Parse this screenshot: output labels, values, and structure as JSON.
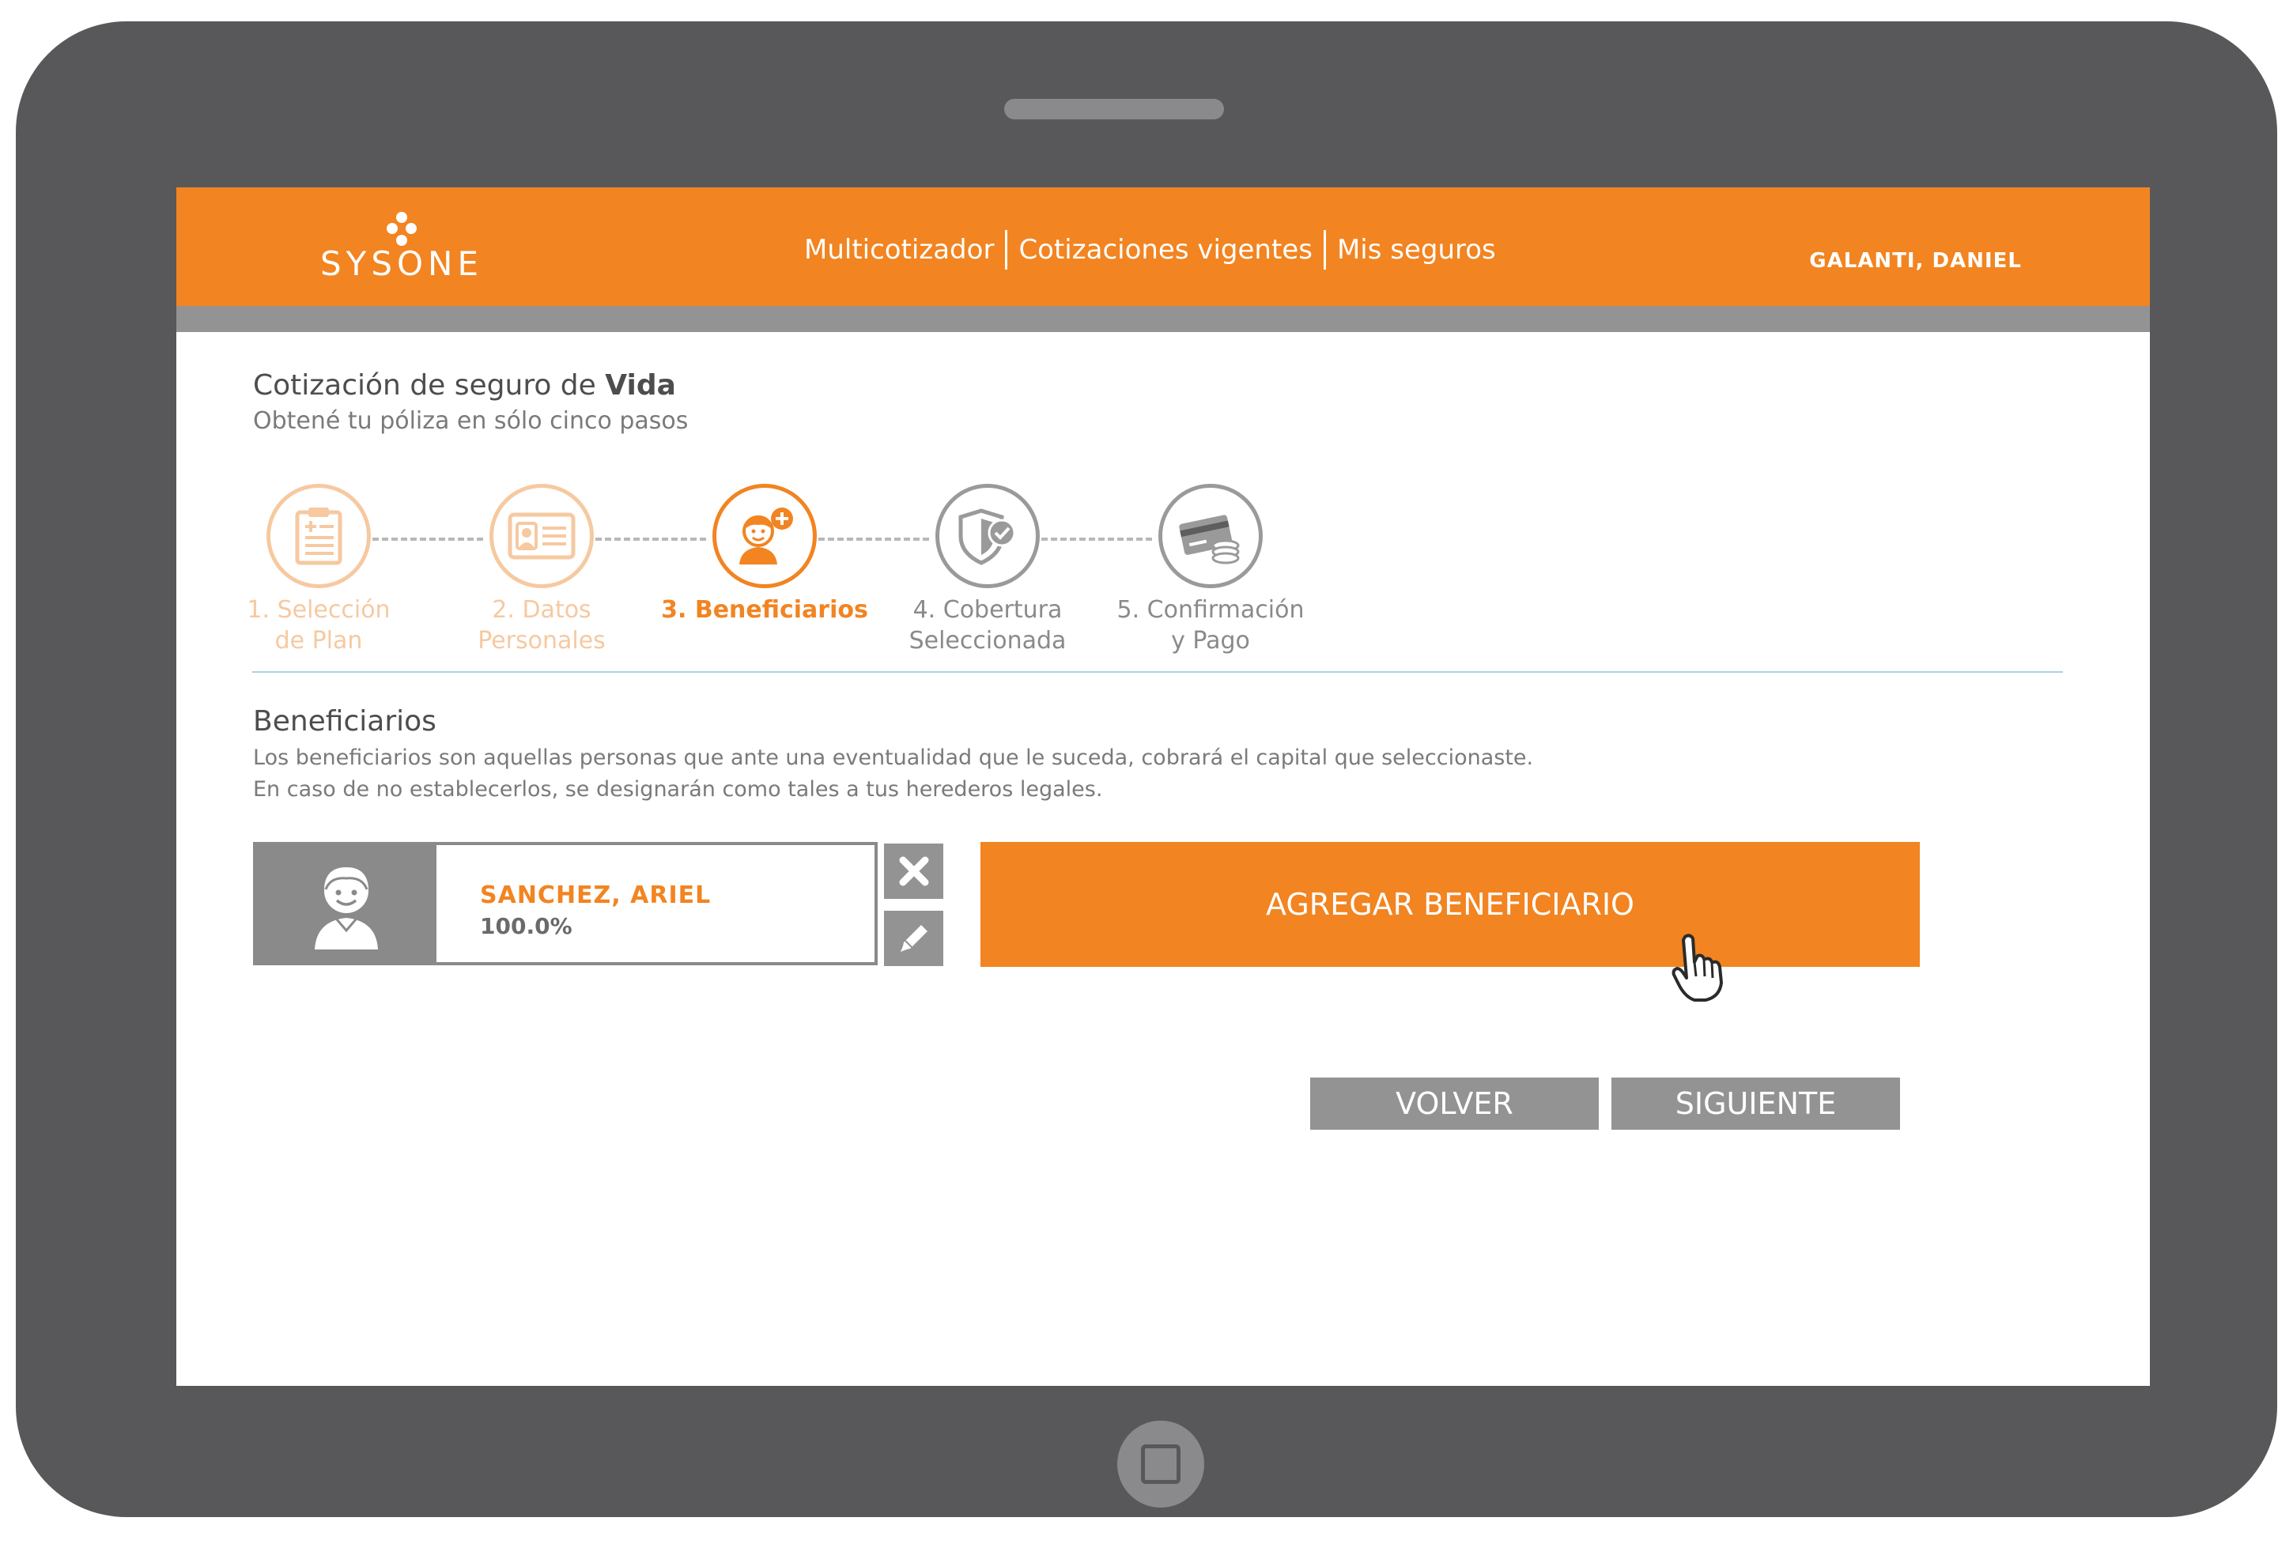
{
  "header": {
    "logo_text": "SYSONE",
    "nav": [
      "Multicotizador",
      "Cotizaciones vigentes",
      "Mis seguros"
    ],
    "user": "GALANTI, DANIEL"
  },
  "page": {
    "title_prefix": "Cotización de seguro de ",
    "title_bold": "Vida",
    "subtitle": "Obtené tu póliza en sólo cinco pasos"
  },
  "steps": [
    {
      "label": "1. Selección\nde Plan",
      "state": "done",
      "icon": "clipboard-icon"
    },
    {
      "label": "2. Datos\nPersonales",
      "state": "done",
      "icon": "id-card-icon"
    },
    {
      "label": "3. Beneficiarios",
      "state": "active",
      "icon": "add-person-icon"
    },
    {
      "label": "4. Cobertura\nSeleccionada",
      "state": "todo",
      "icon": "shield-check-icon"
    },
    {
      "label": "5. Confirmación\ny Pago",
      "state": "todo",
      "icon": "card-coins-icon"
    }
  ],
  "section": {
    "title": "Beneficiarios",
    "desc_line1": "Los beneficiarios son aquellas personas que ante una eventualidad que le suceda, cobrará el capital que seleccionaste.",
    "desc_line2": "En caso de no establecerlos,  se designarán como tales a tus herederos legales."
  },
  "beneficiary": {
    "name": "SANCHEZ, ARIEL",
    "percent": "100.0%"
  },
  "buttons": {
    "add": "AGREGAR BENEFICIARIO",
    "back": "VOLVER",
    "next": "SIGUIENTE"
  },
  "colors": {
    "brand_orange": "#f28421",
    "done_orange": "#f6c9a1",
    "gray": "#939393",
    "device": "#58585a"
  }
}
